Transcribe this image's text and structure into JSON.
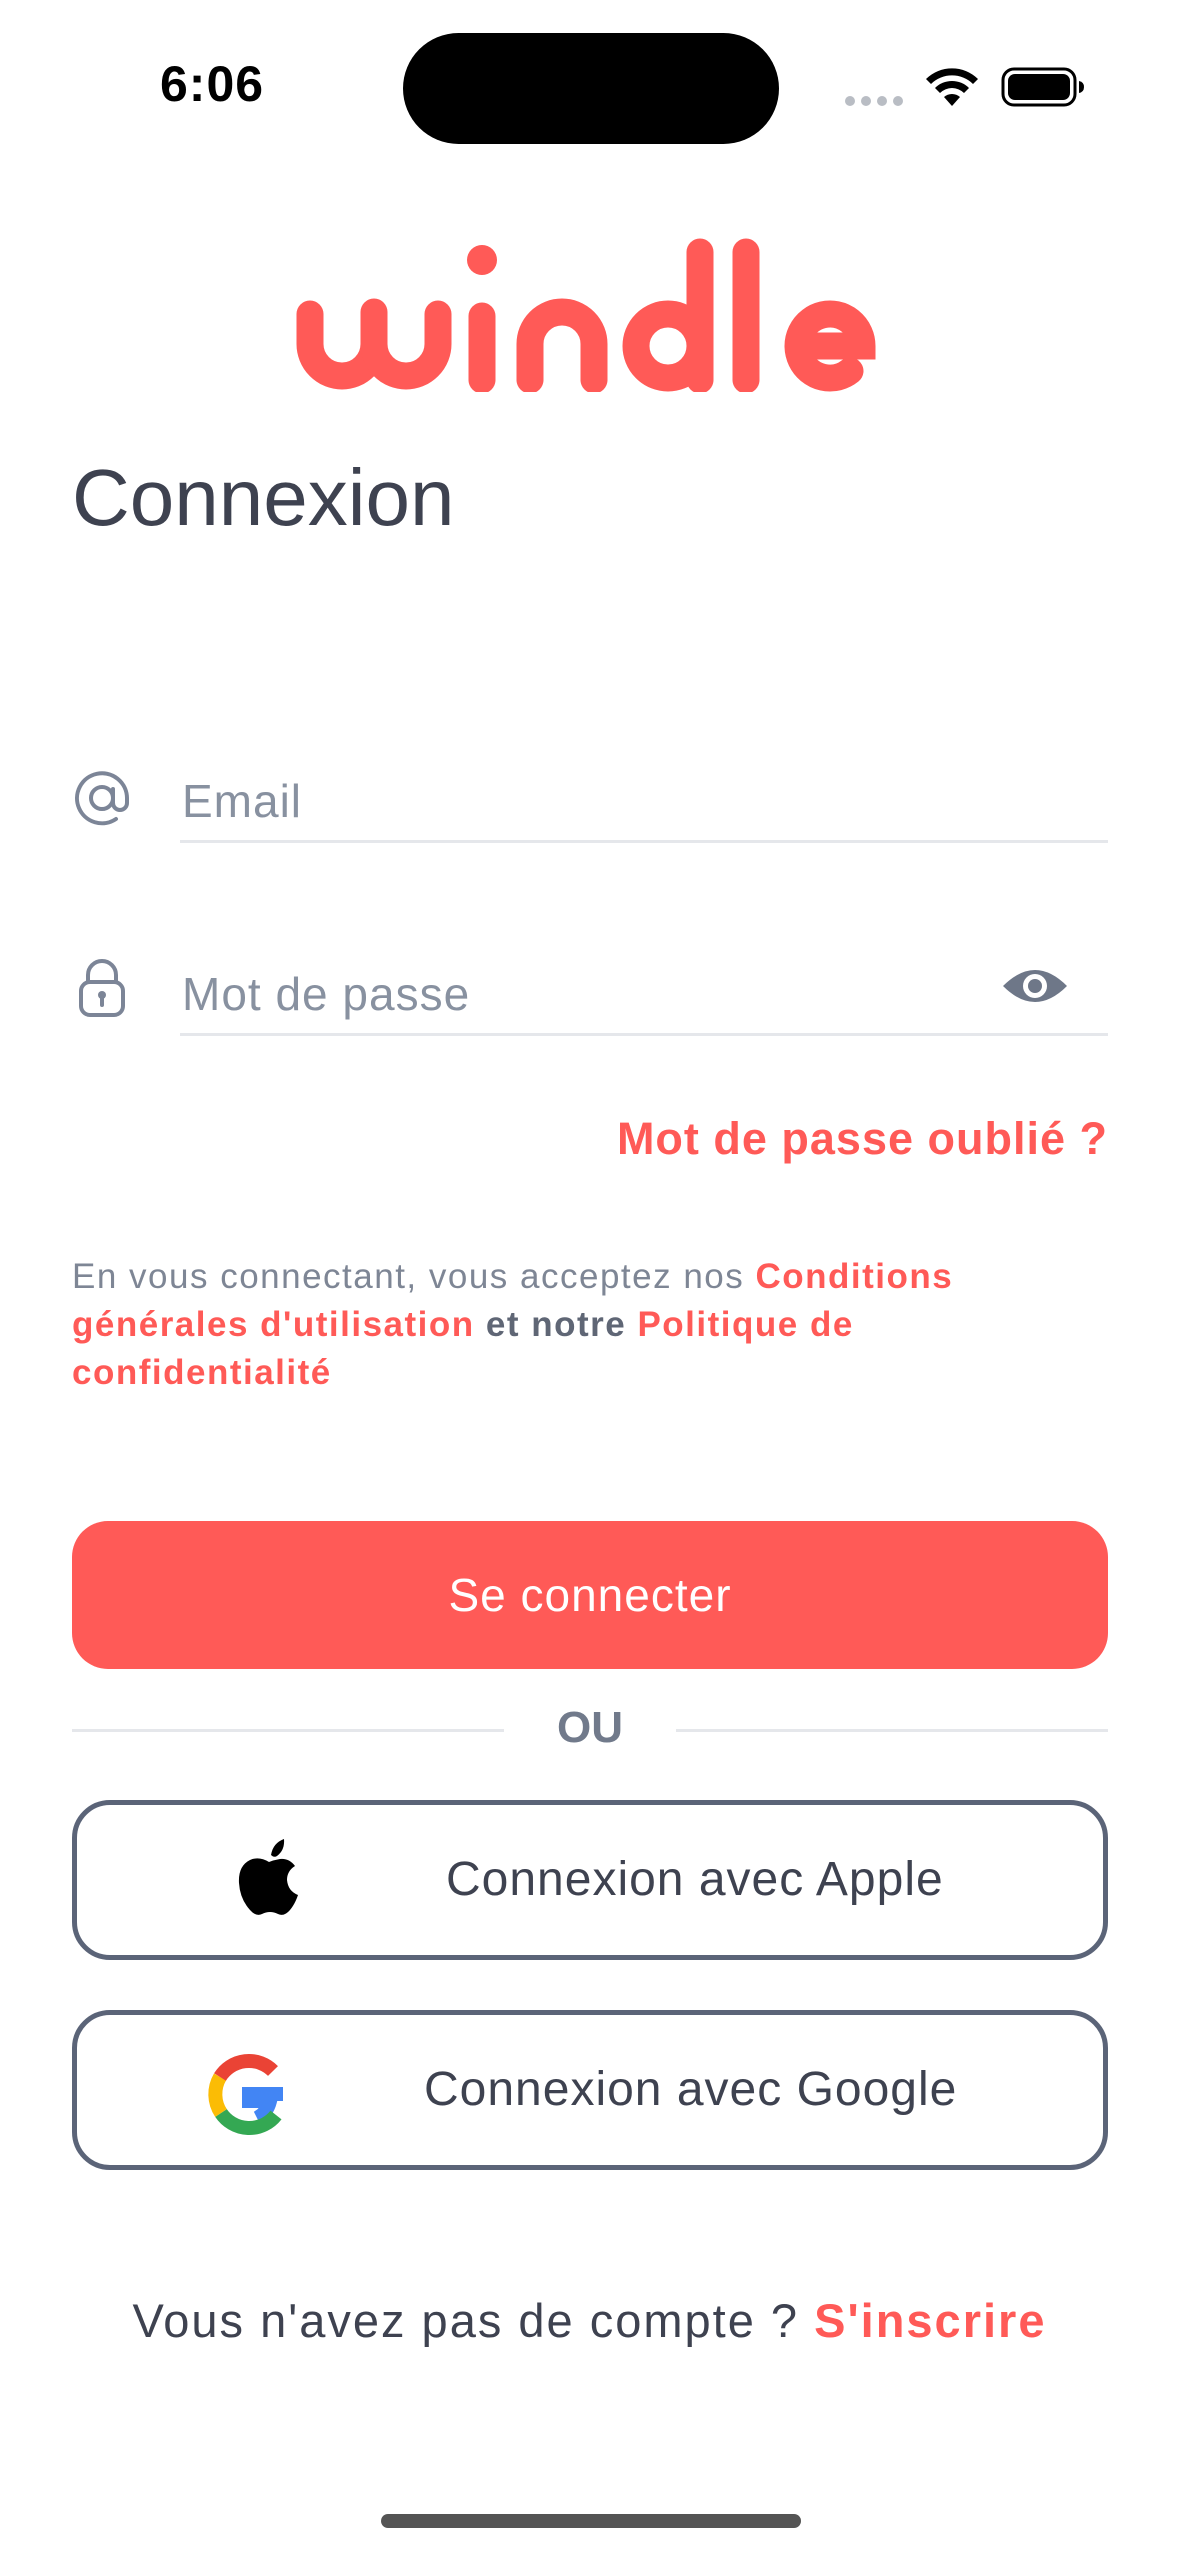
{
  "status_bar": {
    "time": "6:06"
  },
  "brand": {
    "name": "windle",
    "color": "#ff5a57"
  },
  "page": {
    "title": "Connexion"
  },
  "form": {
    "email_placeholder": "Email",
    "email_icon": "at-icon",
    "password_placeholder": "Mot de passe",
    "password_icon": "lock-icon",
    "toggle_visibility_icon": "eye-icon",
    "forgot_password": "Mot de passe oublié ?"
  },
  "terms": {
    "prefix": "En vous connectant, vous acceptez nos ",
    "cgu_link": "Conditions générales d'utilisation",
    "middle": " et notre ",
    "privacy_link": "Politique de confidentialité"
  },
  "actions": {
    "login_label": "Se connecter",
    "divider_label": "OU",
    "apple_label": "Connexion avec Apple",
    "google_label": "Connexion avec Google"
  },
  "signup": {
    "prompt": "Vous n'avez pas de compte ? ",
    "link": "S'inscrire"
  },
  "colors": {
    "accent": "#ff5a57",
    "text": "#3e4250",
    "muted": "#8891a0",
    "outline": "#5b6478"
  }
}
